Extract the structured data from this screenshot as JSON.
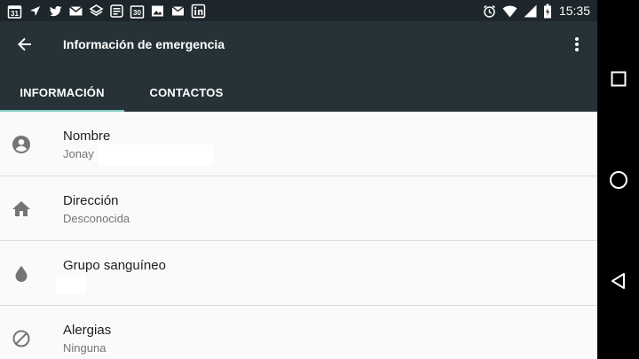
{
  "status_bar": {
    "time": "15:35",
    "left_icons": [
      "calendar-31-icon",
      "navigation-icon",
      "twitter-icon",
      "gmail-icon",
      "dropbox-icon",
      "news-icon",
      "calendar-30-icon",
      "image-icon",
      "inbox-icon",
      "linkedin-icon"
    ],
    "right_icons": [
      "alarm-icon",
      "wifi-icon",
      "signal-icon",
      "battery-icon"
    ],
    "calendar_day_1": "31",
    "calendar_day_2": "30"
  },
  "app_bar": {
    "title": "Información de emergencia",
    "tabs": [
      {
        "label": "INFORMACIÓN",
        "active": true
      },
      {
        "label": "CONTACTOS",
        "active": false
      }
    ],
    "background": "#263238",
    "tab_indicator": "#80cbc4"
  },
  "list": {
    "items": [
      {
        "title": "Nombre",
        "subtitle": "Jonay",
        "icon": "person-icon"
      },
      {
        "title": "Dirección",
        "subtitle": "Desconocida",
        "icon": "home-icon"
      },
      {
        "title": "Grupo sanguíneo",
        "subtitle": "",
        "icon": "blood-drop-icon"
      },
      {
        "title": "Alergias",
        "subtitle": "Ninguna",
        "icon": "block-icon"
      }
    ]
  },
  "nav_bar": {
    "buttons": [
      "recents-square-icon",
      "home-circle-icon",
      "back-triangle-icon"
    ]
  }
}
